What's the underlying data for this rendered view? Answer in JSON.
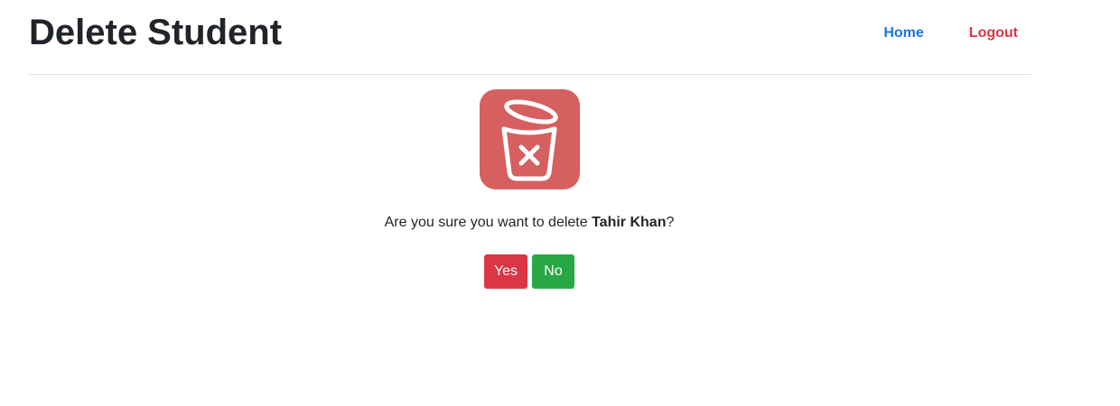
{
  "header": {
    "title": "Delete Student",
    "nav": {
      "home_label": "Home",
      "logout_label": "Logout"
    }
  },
  "dialog": {
    "icon": "trash-delete-icon",
    "prefix": "Are you sure you want to delete ",
    "student_name": "Tahir Khan",
    "suffix": "?",
    "yes_label": "Yes",
    "no_label": "No"
  },
  "colors": {
    "danger": "#dc3545",
    "success": "#28a745",
    "primary": "#1a73e8",
    "icon_bg": "#d65f5f"
  }
}
